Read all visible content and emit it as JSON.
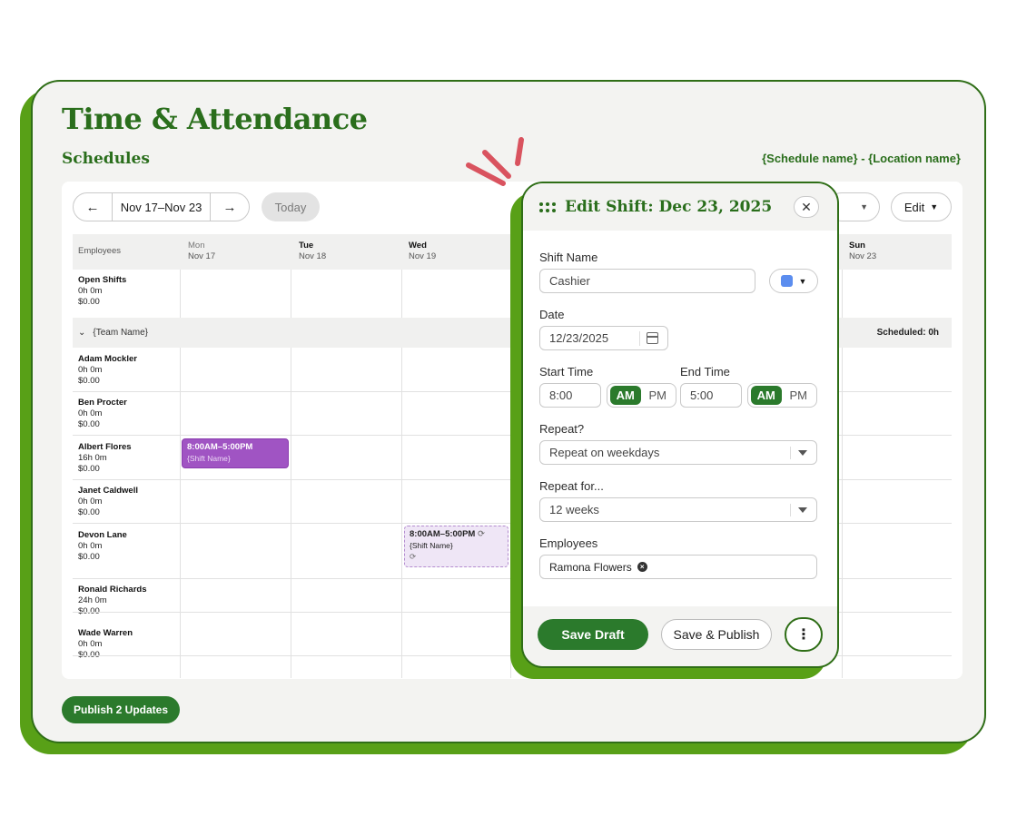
{
  "app": {
    "title": "Time & Attendance"
  },
  "section": {
    "title": "Schedules",
    "schedule_name": "{Schedule name} - {Location name}"
  },
  "toolbar": {
    "prev": "←",
    "next": "→",
    "range": "Nov 17–Nov 23",
    "today": "Today",
    "filter_clear": "✕",
    "edit": "Edit"
  },
  "grid": {
    "employees_header": "Employees",
    "days": [
      {
        "day": "Mon",
        "date": "Nov 17"
      },
      {
        "day": "Tue",
        "date": "Nov 18"
      },
      {
        "day": "Wed",
        "date": "Nov 19"
      },
      {
        "day": "Sun",
        "date": "Nov 23"
      }
    ],
    "open_shifts": {
      "name": "Open Shifts",
      "hours": "0h 0m",
      "cost": "$0.00"
    },
    "team": {
      "name": "{Team Name}",
      "scheduled": "Scheduled: 0h"
    },
    "employees": [
      {
        "name": "Adam Mockler",
        "hours": "0h 0m",
        "cost": "$0.00"
      },
      {
        "name": "Ben Procter",
        "hours": "0h 0m",
        "cost": "$0.00"
      },
      {
        "name": "Albert Flores",
        "hours": "16h 0m",
        "cost": "$0.00"
      },
      {
        "name": "Janet Caldwell",
        "hours": "0h 0m",
        "cost": "$0.00"
      },
      {
        "name": "Devon Lane",
        "hours": "0h 0m",
        "cost": "$0.00"
      },
      {
        "name": "Ronald Richards",
        "hours": "24h 0m",
        "cost": "$0.00"
      },
      {
        "name": "Wade Warren",
        "hours": "0h 0m",
        "cost": "$0.00"
      }
    ],
    "shifts": [
      {
        "time": "8:00AM–5:00PM",
        "name": "{Shift Name}"
      },
      {
        "time": "8:00AM–5:00PM",
        "name": "{Shift Name}"
      }
    ]
  },
  "publish_button": "Publish 2 Updates",
  "modal": {
    "title": "Edit Shift: Dec 23, 2025",
    "close": "✕",
    "shift_name_label": "Shift Name",
    "shift_name_value": "Cashier",
    "color": "#5b8def",
    "date_label": "Date",
    "date_value": "12/23/2025",
    "start_label": "Start Time",
    "start_value": "8:00",
    "end_label": "End Time",
    "end_value": "5:00",
    "am": "AM",
    "pm": "PM",
    "repeat_label": "Repeat?",
    "repeat_value": "Repeat on weekdays",
    "repeat_for_label": "Repeat for...",
    "repeat_for_value": "12 weeks",
    "employees_label": "Employees",
    "employee_chip": "Ramona Flowers",
    "save_draft": "Save Draft",
    "save_publish": "Save & Publish",
    "more": "⋮"
  },
  "colors": {
    "brand_green": "#2a6e1c",
    "accent_green": "#58a017",
    "shift_purple": "#a054c3",
    "spark_red": "#d9535f"
  }
}
